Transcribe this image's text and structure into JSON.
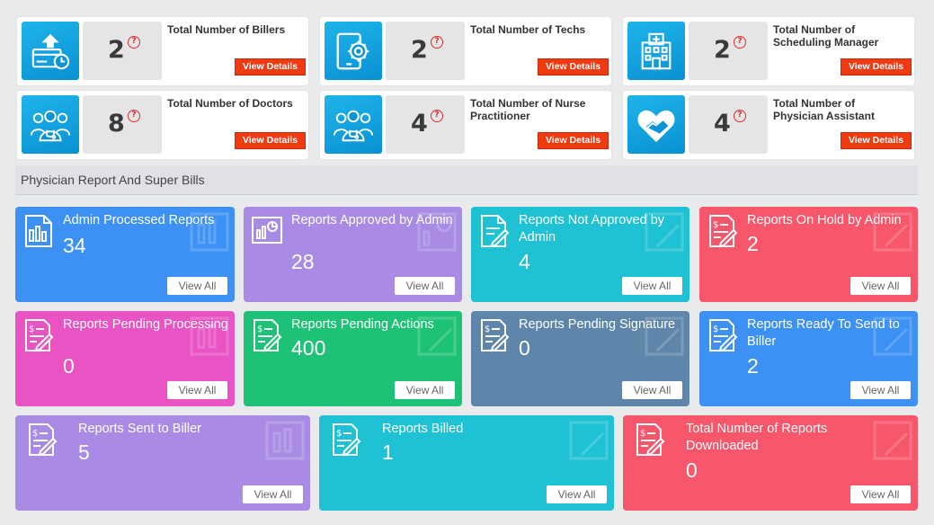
{
  "stats": [
    {
      "count": "2",
      "help": "?",
      "title": "Total Number of Billers",
      "button": "View Details"
    },
    {
      "count": "2",
      "help": "?",
      "title": "Total Number of Techs",
      "button": "View Details"
    },
    {
      "count": "2",
      "help": "?",
      "title": "Total Number of Scheduling Manager",
      "button": "View Details"
    },
    {
      "count": "8",
      "help": "?",
      "title": "Total Number of Doctors",
      "button": "View Details"
    },
    {
      "count": "4",
      "help": "?",
      "title": "Total Number of Nurse Practitioner",
      "button": "View Details"
    },
    {
      "count": "4",
      "help": "?",
      "title": "Total Number of Physician Assistant",
      "button": "View Details"
    }
  ],
  "stat_icons": [
    "biller-icon",
    "tech-tablet-gear-icon",
    "hospital-icon",
    "doctors-icon",
    "nurses-icon",
    "heart-handshake-icon"
  ],
  "section": {
    "title": "Physician Report And Super Bills"
  },
  "tiles": [
    {
      "label": "Admin Processed Reports",
      "value": "34",
      "button": "View All",
      "icon": "report-chart-icon",
      "color": "#3d91f5"
    },
    {
      "label": "Reports Approved by Admin",
      "value": "28",
      "button": "View All",
      "icon": "report-chart-icon",
      "color": "#a98be5"
    },
    {
      "label": "Reports Not Approved by Admin",
      "value": "4",
      "button": "View All",
      "icon": "document-edit-icon",
      "color": "#1fc1d4"
    },
    {
      "label": "Reports On Hold by Admin",
      "value": "2",
      "button": "View All",
      "icon": "invoice-edit-icon",
      "color": "#f7566b"
    },
    {
      "label": "Reports Pending Processing",
      "value": "0",
      "button": "View All",
      "icon": "invoice-edit-icon",
      "color": "#ea53c3"
    },
    {
      "label": "Reports Pending Actions",
      "value": "400",
      "button": "View All",
      "icon": "invoice-edit-icon",
      "color": "#1ec276"
    },
    {
      "label": "Reports Pending Signature",
      "value": "0",
      "button": "View All",
      "icon": "invoice-edit-icon",
      "color": "#5e86aa"
    },
    {
      "label": "Reports Ready To Send to Biller",
      "value": "2",
      "button": "View All",
      "icon": "invoice-edit-icon",
      "color": "#3d91f5"
    },
    {
      "label": "Reports Sent to Biller",
      "value": "5",
      "button": "View All",
      "icon": "invoice-edit-icon",
      "color": "#a98be5"
    },
    {
      "label": "Reports Billed",
      "value": "1",
      "button": "View All",
      "icon": "invoice-edit-icon",
      "color": "#1fc1d4"
    },
    {
      "label": "Total Number of Reports Downloaded",
      "value": "0",
      "button": "View All",
      "icon": "invoice-edit-icon",
      "color": "#f7566b"
    }
  ]
}
